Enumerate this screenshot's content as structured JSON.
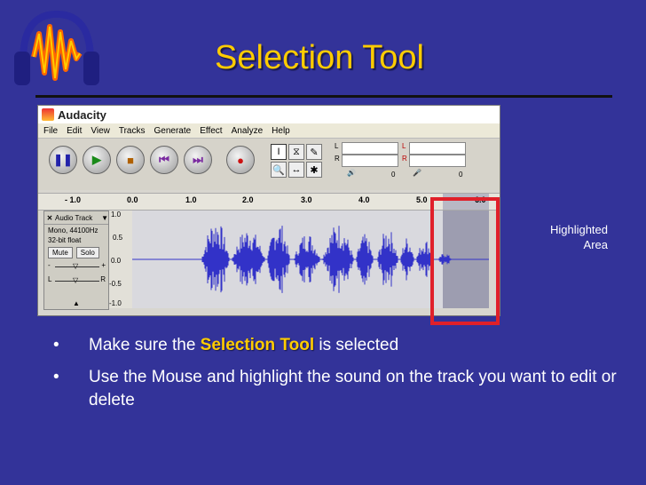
{
  "slide": {
    "title": "Selection Tool",
    "highlight_label": "Highlighted Area",
    "bullets": [
      {
        "prefix": "Make sure the ",
        "emphasis": "Selection Tool",
        "suffix": " is selected"
      },
      {
        "text": "Use the Mouse and highlight the sound on the track you want to edit or delete"
      }
    ],
    "bullet_glyph": "•"
  },
  "app": {
    "title": "Audacity",
    "menu": [
      "File",
      "Edit",
      "View",
      "Tracks",
      "Generate",
      "Effect",
      "Analyze",
      "Help"
    ],
    "transport_buttons": [
      {
        "name": "pause-icon",
        "glyph": "❚❚"
      },
      {
        "name": "play-icon",
        "glyph": "▶"
      },
      {
        "name": "stop-icon",
        "glyph": "■"
      },
      {
        "name": "skip-start-icon",
        "glyph": "⏮"
      },
      {
        "name": "skip-end-icon",
        "glyph": "⏭"
      },
      {
        "name": "record-icon",
        "glyph": "●"
      }
    ],
    "tools": [
      {
        "name": "selection-tool-icon",
        "glyph": "I"
      },
      {
        "name": "envelope-tool-icon",
        "glyph": "⧖"
      },
      {
        "name": "draw-tool-icon",
        "glyph": "✎"
      },
      {
        "name": "zoom-tool-icon",
        "glyph": "🔍"
      },
      {
        "name": "timeshift-tool-icon",
        "glyph": "↔"
      },
      {
        "name": "multi-tool-icon",
        "glyph": "✱"
      }
    ],
    "meters": {
      "left_label": "L",
      "right_label": "R",
      "play_zero": "0",
      "rec_zero": "0"
    },
    "ruler_ticks": [
      "- 1.0",
      "0.0",
      "1.0",
      "2.0",
      "3.0",
      "4.0",
      "5.0",
      "6.0"
    ],
    "track": {
      "name": "Audio Track",
      "info1": "Mono, 44100Hz",
      "info2": "32-bit float",
      "mute": "Mute",
      "solo": "Solo",
      "gain_minus": "-",
      "gain_plus": "+",
      "pan_l": "L",
      "pan_r": "R",
      "vscale": [
        "1.0",
        "0.5",
        "0.0",
        "-0.5",
        "-1.0"
      ]
    }
  },
  "colors": {
    "background": "#333399",
    "title": "#ffcc00",
    "waveform": "#3232c8",
    "highlight_box": "#e0202a"
  }
}
